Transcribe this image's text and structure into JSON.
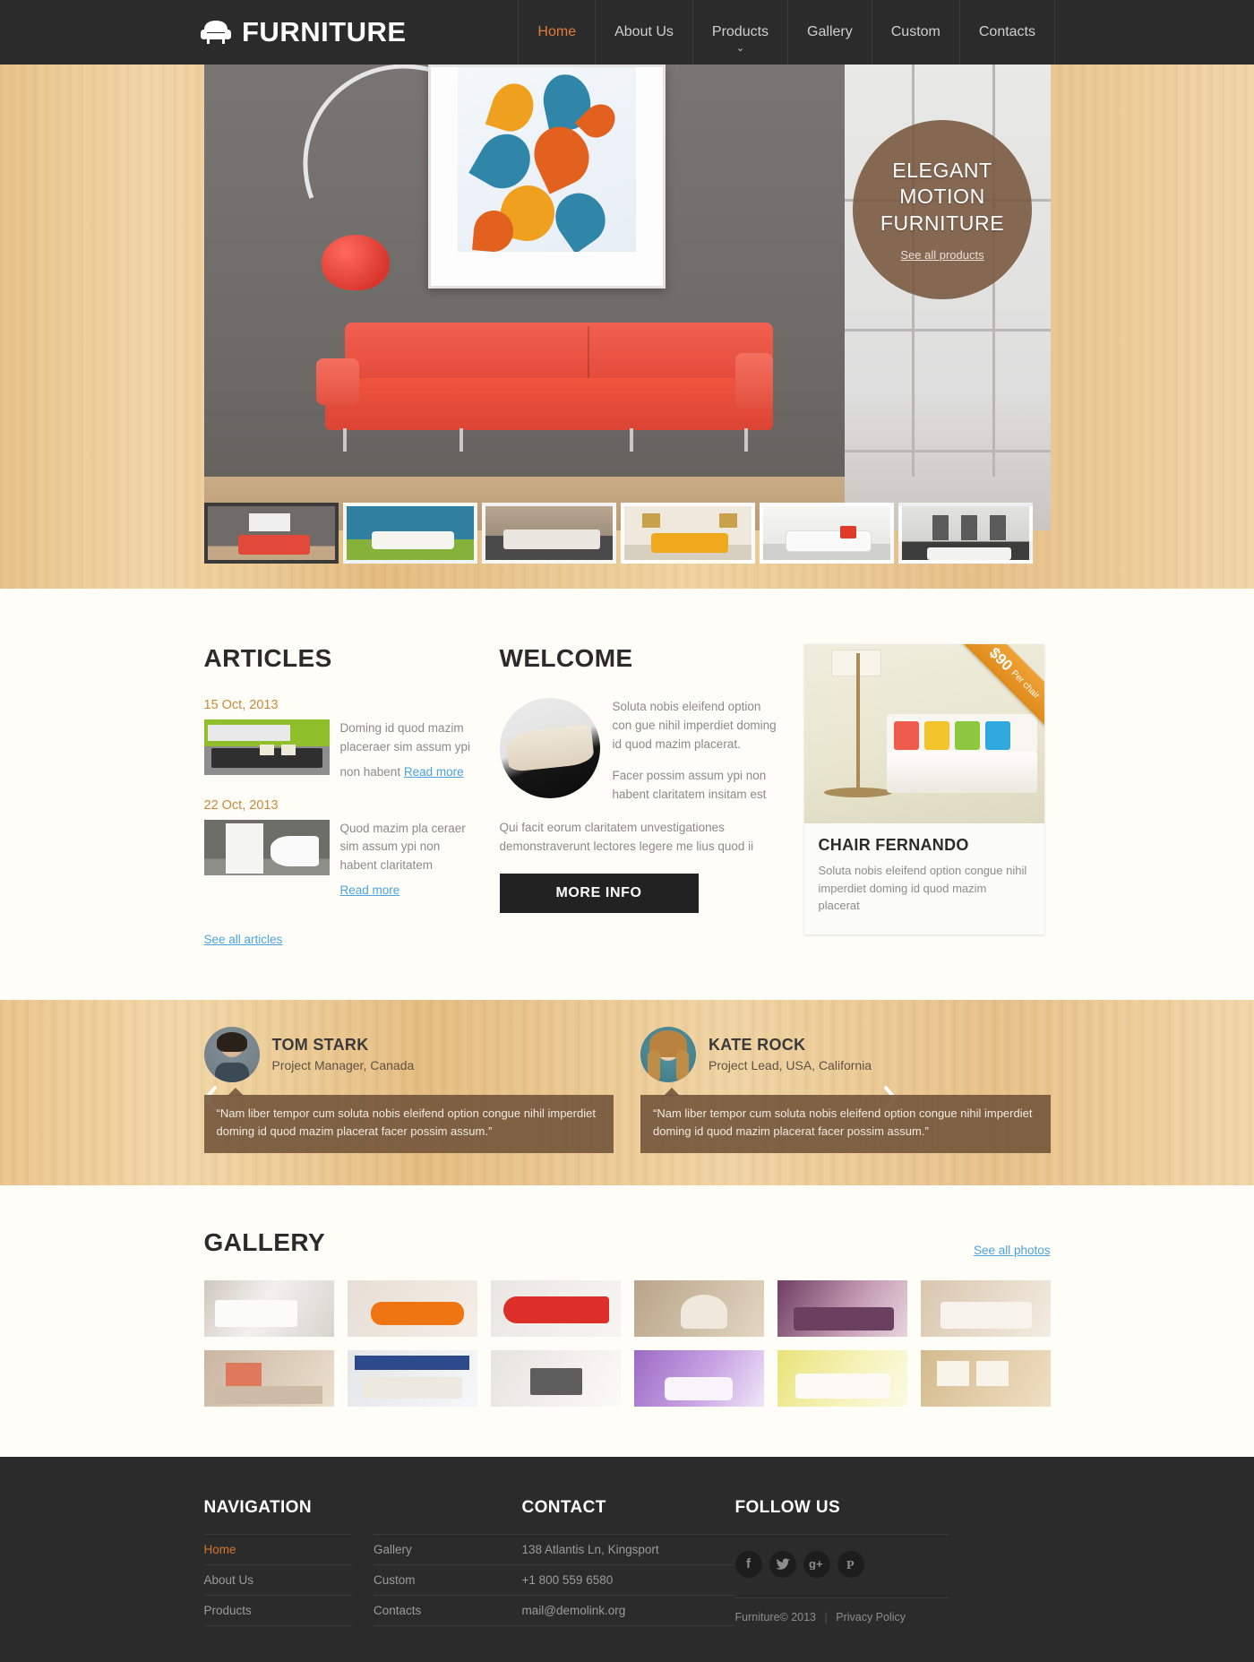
{
  "header": {
    "logo_text": "FURNITURE",
    "logo_icon": "armchair-icon",
    "nav": [
      {
        "label": "Home",
        "active": true,
        "caret": ""
      },
      {
        "label": "About Us",
        "active": false,
        "caret": ""
      },
      {
        "label": "Products",
        "active": false,
        "caret": "⌄"
      },
      {
        "label": "Gallery",
        "active": false,
        "caret": ""
      },
      {
        "label": "Custom",
        "active": false,
        "caret": ""
      },
      {
        "label": "Contacts",
        "active": false,
        "caret": ""
      }
    ]
  },
  "hero": {
    "badge_line1": "ELEGANT",
    "badge_line2": "MOTION",
    "badge_line3": "FURNITURE",
    "badge_link": "See all products"
  },
  "articles": {
    "title": "ARTICLES",
    "items": [
      {
        "date": "15 Oct, 2013",
        "text": "Doming id quod mazim placeraer sim assum ypi non habent",
        "link": "Read more"
      },
      {
        "date": "22 Oct, 2013",
        "text": "Quod mazim pla ceraer sim assum ypi non habent claritatem",
        "link": "Read more"
      }
    ],
    "see_all": "See all articles"
  },
  "welcome": {
    "title": "WELCOME",
    "para1": "Soluta nobis eleifend option con gue nihil imperdiet doming id quod mazim placerat.",
    "para2": "Facer possim assum ypi non habent claritatem insitam est",
    "para3": "Qui facit eorum claritatem unvestigationes demonstraverunt lectores legere me lius quod ii",
    "button": "MORE INFO"
  },
  "product": {
    "price": "$90",
    "price_per": "Per chair",
    "title": "CHAIR FERNANDO",
    "desc": "Soluta nobis eleifend option congue nihil imperdiet doming id quod mazim placerat"
  },
  "testimonials": {
    "prev_icon": "chevron-left-icon",
    "next_icon": "chevron-right-icon",
    "items": [
      {
        "name": "TOM STARK",
        "role": "Project Manager, Canada",
        "quote": "“Nam liber tempor cum soluta nobis eleifend option congue nihil imperdiet doming id quod mazim placerat facer possim assum.”"
      },
      {
        "name": "KATE ROCK",
        "role": "Project Lead, USA, California",
        "quote": "“Nam liber tempor cum soluta nobis eleifend option congue nihil imperdiet doming id quod mazim placerat facer possim assum.”"
      }
    ]
  },
  "gallery": {
    "title": "GALLERY",
    "see_all": "See all photos"
  },
  "footer": {
    "nav_title": "NAVIGATION",
    "nav_col1": [
      {
        "label": "Home",
        "active": true
      },
      {
        "label": "About Us",
        "active": false
      },
      {
        "label": "Products",
        "active": false
      }
    ],
    "nav_col2": [
      {
        "label": "Gallery",
        "active": false
      },
      {
        "label": "Custom",
        "active": false
      },
      {
        "label": "Contacts",
        "active": false
      }
    ],
    "contact_title": "CONTACT",
    "contact_lines": [
      "138 Atlantis Ln, Kingsport",
      "+1 800 559 6580",
      "mail@demolink.org"
    ],
    "follow_title": "FOLLOW US",
    "socials": [
      {
        "icon": "facebook-icon",
        "glyph": "f"
      },
      {
        "icon": "twitter-icon",
        "glyph": "ʈ"
      },
      {
        "icon": "google-plus-icon",
        "glyph": "g"
      },
      {
        "icon": "pinterest-icon",
        "glyph": "ρ"
      }
    ],
    "copyright": "Furniture© 2013",
    "privacy": "Privacy Policy"
  },
  "colors": {
    "accent_orange": "#e07b39",
    "link_blue": "#4aa3df",
    "dark": "#2b2b2b",
    "wood": "#eecb93",
    "brown_badge": "#78563d",
    "ribbon": "#e08b1e"
  }
}
